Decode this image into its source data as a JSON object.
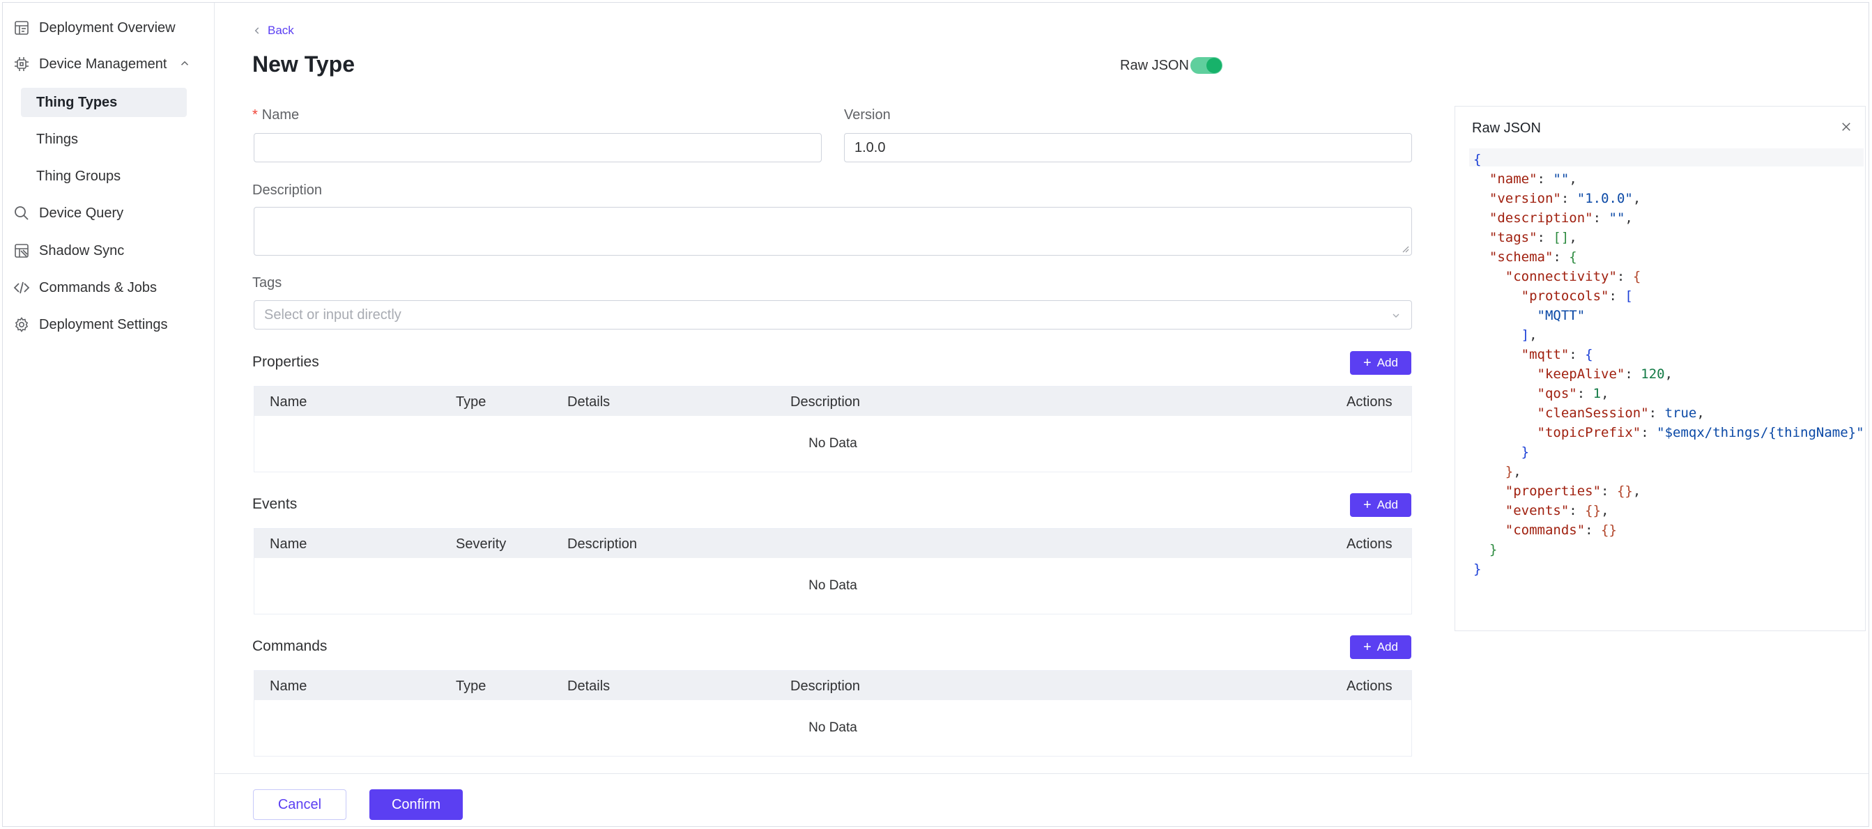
{
  "sidebar": {
    "items": [
      {
        "label": "Deployment Overview",
        "icon": "dashboard-icon"
      },
      {
        "label": "Device Management",
        "icon": "chip-icon"
      },
      {
        "label": "Device Query",
        "icon": "search-icon"
      },
      {
        "label": "Shadow Sync",
        "icon": "shadow-sync-icon"
      },
      {
        "label": "Commands & Jobs",
        "icon": "code-icon"
      },
      {
        "label": "Deployment Settings",
        "icon": "gear-icon"
      }
    ],
    "sub_items": [
      {
        "label": "Thing Types",
        "active": true
      },
      {
        "label": "Things",
        "active": false
      },
      {
        "label": "Thing Groups",
        "active": false
      }
    ]
  },
  "header": {
    "back_label": "Back",
    "title": "New Type",
    "raw_json_label": "Raw JSON",
    "raw_json_enabled": true
  },
  "form": {
    "name_label": "Name",
    "name_required_mark": "*",
    "name_value": "",
    "version_label": "Version",
    "version_value": "1.0.0",
    "description_label": "Description",
    "description_value": "",
    "tags_label": "Tags",
    "tags_placeholder": "Select or input directly"
  },
  "sections": {
    "add_label": "Add",
    "empty_text": "No Data",
    "properties": {
      "title": "Properties",
      "columns": [
        "Name",
        "Type",
        "Details",
        "Description",
        "Actions"
      ]
    },
    "events": {
      "title": "Events",
      "columns": [
        "Name",
        "Severity",
        "Description",
        "Actions"
      ]
    },
    "commands": {
      "title": "Commands",
      "columns": [
        "Name",
        "Type",
        "Details",
        "Description",
        "Actions"
      ]
    }
  },
  "footer": {
    "cancel_label": "Cancel",
    "confirm_label": "Confirm"
  },
  "json_panel": {
    "title": "Raw JSON",
    "schema": {
      "name": "",
      "version": "1.0.0",
      "description": "",
      "tags": [],
      "connectivity": {
        "protocols": [
          "MQTT"
        ],
        "mqtt": {
          "keepAlive": 120,
          "qos": 1,
          "cleanSession": true,
          "topicPrefix": "$emqx/things/{thingName}"
        }
      },
      "properties": {},
      "events": {},
      "commands": {}
    }
  },
  "colors": {
    "accent": "#5b3ff2",
    "toggle_on": "#17b26a",
    "required": "#f04438"
  }
}
